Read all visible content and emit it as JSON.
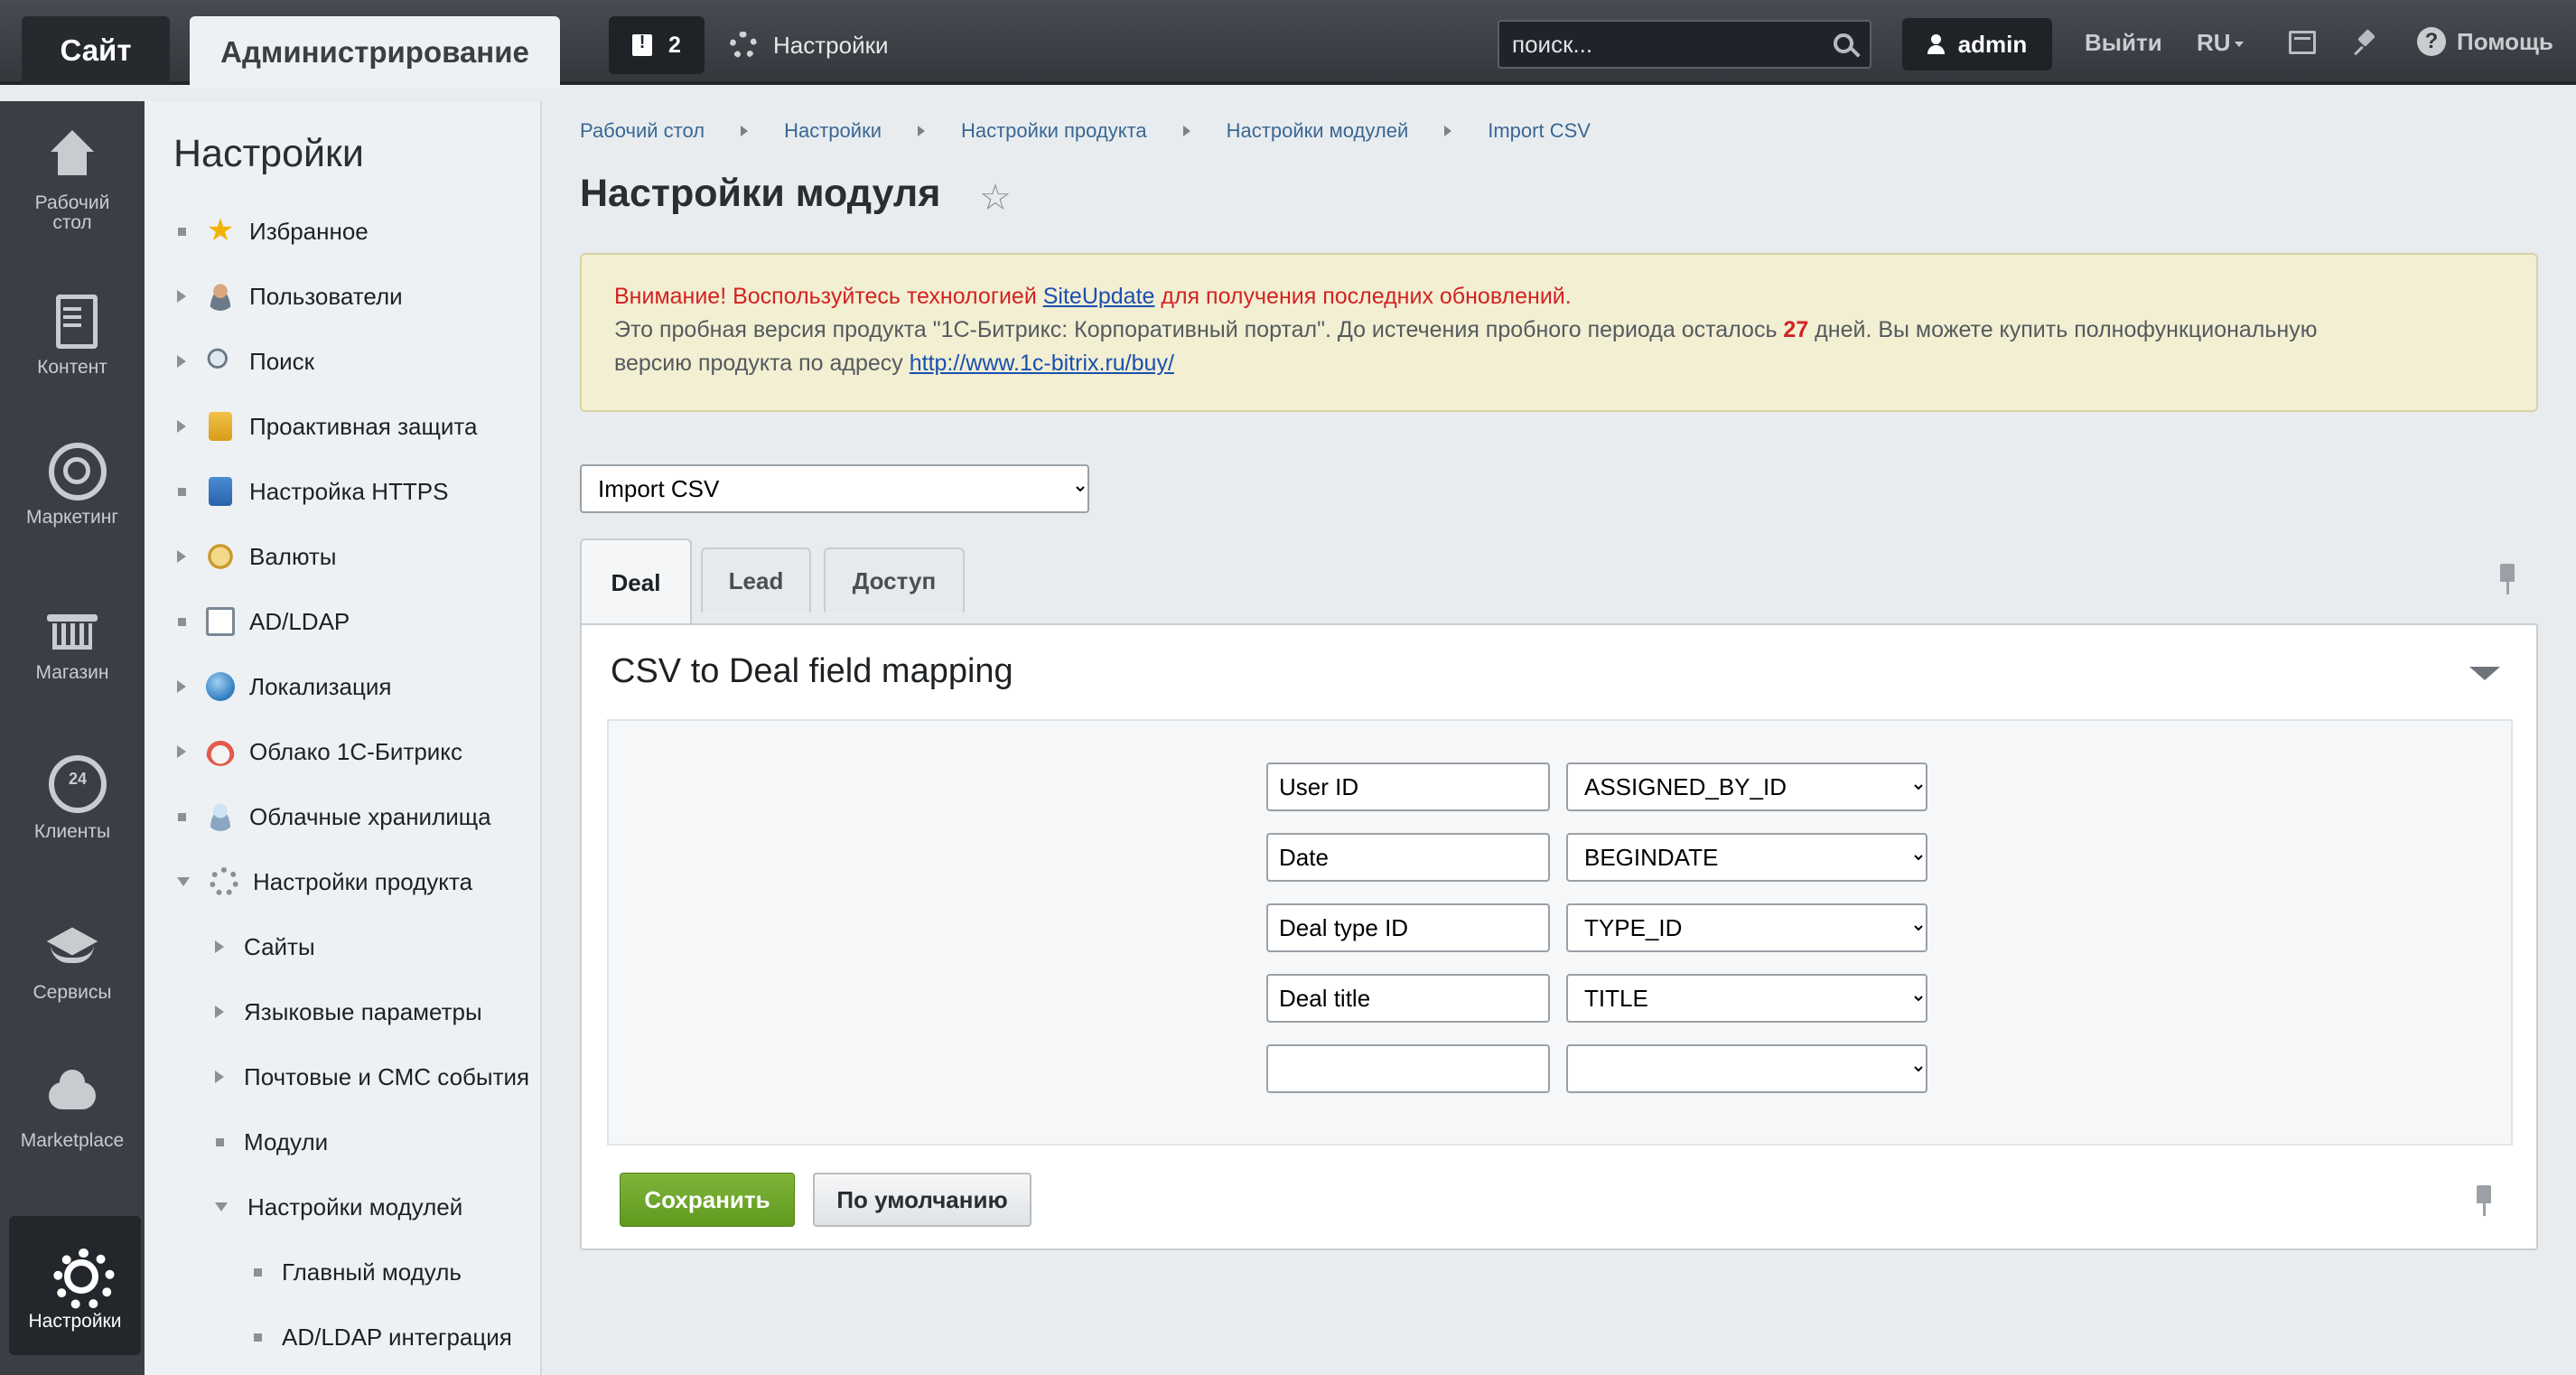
{
  "topbar": {
    "site_tab": "Сайт",
    "admin_tab": "Администрирование",
    "notifications_count": "2",
    "settings_label": "Настройки",
    "search_placeholder": "поиск...",
    "user": "admin",
    "logout": "Выйти",
    "lang": "RU",
    "help": "Помощь"
  },
  "iconbar": {
    "items": [
      {
        "label": "Рабочий стол",
        "icon": "house-icon"
      },
      {
        "label": "Контент",
        "icon": "document-icon"
      },
      {
        "label": "Маркетинг",
        "icon": "target-icon"
      },
      {
        "label": "Магазин",
        "icon": "basket-icon"
      },
      {
        "label": "Клиенты",
        "icon": "clients-24-icon"
      },
      {
        "label": "Сервисы",
        "icon": "layers-icon"
      },
      {
        "label": "Marketplace",
        "icon": "cloud-download-icon"
      },
      {
        "label": "Настройки",
        "icon": "gear-icon",
        "active": true
      }
    ]
  },
  "menu": {
    "title": "Настройки",
    "items": [
      {
        "label": "Избранное",
        "marker": "dot",
        "icon": "star-icon"
      },
      {
        "label": "Пользователи",
        "marker": "arrow",
        "icon": "user-icon"
      },
      {
        "label": "Поиск",
        "marker": "arrow",
        "icon": "search-icon"
      },
      {
        "label": "Проактивная защита",
        "marker": "arrow",
        "icon": "lock-icon"
      },
      {
        "label": "Настройка HTTPS",
        "marker": "dot",
        "icon": "https-lock-icon"
      },
      {
        "label": "Валюты",
        "marker": "arrow",
        "icon": "coin-icon"
      },
      {
        "label": "AD/LDAP",
        "marker": "dot",
        "icon": "ldap-icon"
      },
      {
        "label": "Локализация",
        "marker": "arrow",
        "icon": "globe-icon"
      },
      {
        "label": "Облако 1С-Битрикс",
        "marker": "arrow",
        "icon": "cloud-icon"
      },
      {
        "label": "Облачные хранилища",
        "marker": "dot",
        "icon": "storage-icon"
      },
      {
        "label": "Настройки продукта",
        "marker": "arrow-down",
        "icon": "gear-icon"
      },
      {
        "label": "Сайты",
        "marker": "arrow"
      },
      {
        "label": "Языковые параметры",
        "marker": "arrow"
      },
      {
        "label": "Почтовые и СМС события",
        "marker": "arrow"
      },
      {
        "label": "Модули",
        "marker": "dot"
      },
      {
        "label": "Настройки модулей",
        "marker": "arrow-down"
      },
      {
        "label": "Главный модуль",
        "marker": "dot"
      },
      {
        "label": "AD/LDAP интеграция",
        "marker": "dot"
      }
    ]
  },
  "breadcrumb": [
    "Рабочий стол",
    "Настройки",
    "Настройки продукта",
    "Настройки модулей",
    "Import CSV"
  ],
  "page_title": "Настройки модуля",
  "alert": {
    "line1_before": "Внимание! Воспользуйтесь технологией ",
    "line1_link": "SiteUpdate",
    "line1_after": " для получения последних обновлений.",
    "line2_before": "Это пробная версия продукта \"1С-Битрикс: Корпоративный портал\". До истечения пробного периода осталось ",
    "days": "27",
    "line2_after": " дней. Вы можете купить полнофункциональную",
    "line3_before": "версию продукта по адресу ",
    "line3_link": "http://www.1c-bitrix.ru/buy/"
  },
  "module_select": "Import CSV",
  "tabs": [
    "Deal",
    "Lead",
    "Доступ"
  ],
  "panel_title": "CSV to Deal field mapping",
  "mappings": [
    {
      "csv": "User ID",
      "field": "ASSIGNED_BY_ID"
    },
    {
      "csv": "Date",
      "field": "BEGINDATE"
    },
    {
      "csv": "Deal type ID",
      "field": "TYPE_ID"
    },
    {
      "csv": "Deal title",
      "field": "TITLE"
    },
    {
      "csv": "",
      "field": ""
    }
  ],
  "buttons": {
    "save": "Сохранить",
    "default": "По умолчанию"
  }
}
